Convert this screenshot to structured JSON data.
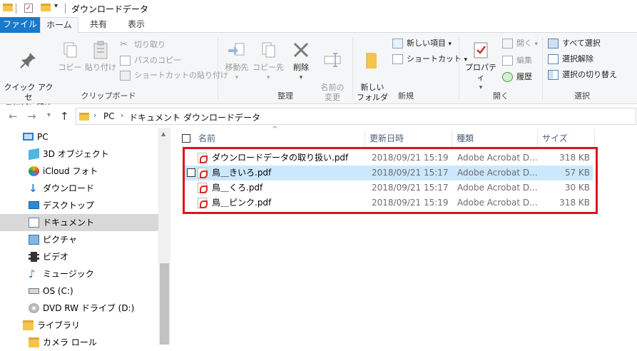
{
  "window": {
    "title": "ダウンロードデータ"
  },
  "tabs": [
    {
      "label": "ファイル"
    },
    {
      "label": "ホーム"
    },
    {
      "label": "共有"
    },
    {
      "label": "表示"
    }
  ],
  "ribbon": {
    "clipboard": {
      "label": "クリップボード",
      "pin_quick": "クイック アクセ\nスにピン留め",
      "copy": "コピー",
      "paste": "貼り付け",
      "cut": "切り取り",
      "copy_path": "パスのコピー",
      "paste_shortcut": "ショートカットの貼り付け"
    },
    "organize": {
      "label": "整理",
      "move_to": "移動先",
      "copy_to": "コピー先",
      "delete": "削除",
      "rename": "名前の\n変更"
    },
    "new": {
      "label": "新規",
      "new_folder": "新しい\nフォルダー",
      "new_item": "新しい項目",
      "shortcut": "ショートカット"
    },
    "open": {
      "label": "開く",
      "properties": "プロパティ",
      "open": "開く",
      "edit": "編集",
      "history": "履歴"
    },
    "select": {
      "label": "選択",
      "select_all": "すべて選択",
      "select_none": "選択解除",
      "invert": "選択の切り替え"
    }
  },
  "address": {
    "crumbs": [
      "PC",
      "ドキュメント",
      "ダウンロードデータ"
    ]
  },
  "sidebar": {
    "items": [
      {
        "label": "PC"
      },
      {
        "label": "3D オブジェクト"
      },
      {
        "label": "iCloud フォト"
      },
      {
        "label": "ダウンロード"
      },
      {
        "label": "デスクトップ"
      },
      {
        "label": "ドキュメント"
      },
      {
        "label": "ピクチャ"
      },
      {
        "label": "ビデオ"
      },
      {
        "label": "ミュージック"
      },
      {
        "label": "OS (C:)"
      },
      {
        "label": "DVD RW ドライブ (D:)"
      },
      {
        "label": "ライブラリ"
      },
      {
        "label": "カメラ ロール"
      }
    ]
  },
  "columns": {
    "name": "名前",
    "date": "更新日時",
    "type": "種類",
    "size": "サイズ"
  },
  "files": [
    {
      "name": "ダウンロードデータの取り扱い.pdf",
      "date": "2018/09/21 15:19",
      "type": "Adobe Acrobat D...",
      "size": "318 KB"
    },
    {
      "name": "鳥＿きいろ.pdf",
      "date": "2018/09/21 15:17",
      "type": "Adobe Acrobat D...",
      "size": "57 KB"
    },
    {
      "name": "鳥＿くろ.pdf",
      "date": "2018/09/21 15:17",
      "type": "Adobe Acrobat D...",
      "size": "30 KB"
    },
    {
      "name": "鳥＿ピンク.pdf",
      "date": "2018/09/21 15:19",
      "type": "Adobe Acrobat D...",
      "size": "318 KB"
    }
  ],
  "colors": {
    "file_tab": "#1979ca",
    "selection": "#cce8ff",
    "highlight_box": "#d9151c"
  }
}
